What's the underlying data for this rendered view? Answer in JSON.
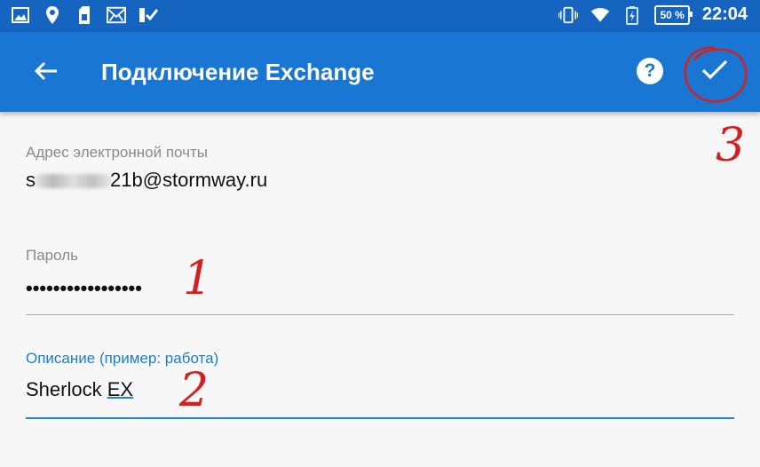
{
  "status_bar": {
    "left_icons": [
      "gallery-icon",
      "location-icon",
      "sim-icon",
      "mail-icon",
      "checklist-icon"
    ],
    "right_icons": [
      "vibrate-icon",
      "wifi-icon",
      "battery-charging-icon"
    ],
    "battery_label": "50 %",
    "time": "22:04"
  },
  "app_bar": {
    "title": "Подключение Exchange",
    "back_icon": "arrow-back-icon",
    "help_label": "?",
    "save_icon": "check-icon"
  },
  "form": {
    "email": {
      "label": "Адрес электронной почты",
      "value_prefix": "s",
      "value_suffix": "21b@stormway.ru"
    },
    "password": {
      "label": "Пароль",
      "value": "•••••••••••••••••"
    },
    "description": {
      "label": "Описание (пример: работа)",
      "value_main": "Sherlock ",
      "value_spell": "EX"
    }
  },
  "annotations": {
    "step1": "1",
    "step2": "2",
    "step3": "3"
  },
  "colors": {
    "status_bar": "#1565c0",
    "app_bar": "#1976d2",
    "accent": "#1a88d8",
    "annotation_red": "#d61f1f"
  }
}
